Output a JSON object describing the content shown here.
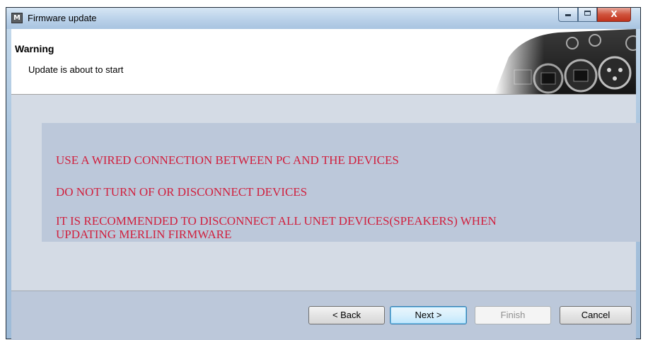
{
  "window": {
    "title": "Firmware update",
    "icon": "M",
    "controls": {
      "minimize_icon": "minimize-icon",
      "maximize_icon": "maximize-icon",
      "close_label": "X"
    }
  },
  "header": {
    "title": "Warning",
    "subtitle": "Update is about to start",
    "image": "hardware-connector-panel"
  },
  "messages": [
    "USE A WIRED CONNECTION BETWEEN PC AND THE DEVICES",
    "DO NOT TURN OF OR DISCONNECT DEVICES",
    "IT IS RECOMMENDED TO DISCONNECT ALL UNET DEVICES(SPEAKERS) WHEN",
    "UPDATING MERLIN FIRMWARE"
  ],
  "buttons": {
    "back": "< Back",
    "next": "Next >",
    "finish": "Finish",
    "cancel": "Cancel"
  },
  "colors": {
    "message_text": "#d0203e",
    "panel": "#bcc8da",
    "body": "#d4dbe5"
  }
}
